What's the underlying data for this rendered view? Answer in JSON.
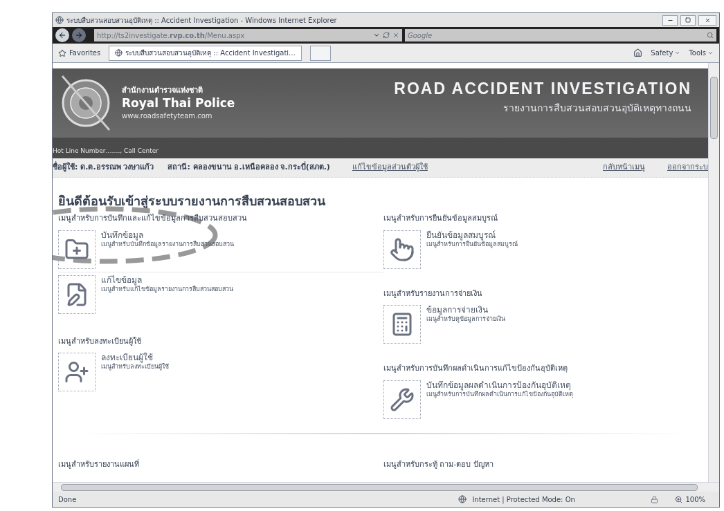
{
  "window": {
    "title": "ระบบสืบสวนสอบสวนอุบัติเหตุ :: Accident Investigation - Windows Internet Explorer"
  },
  "address_bar": {
    "url": "http://ts2investigate.**rvp.co.th**/Menu.aspx"
  },
  "search": {
    "placeholder": "Google"
  },
  "favorites_bar": {
    "favorites": "Favorites",
    "tabs": [
      {
        "title": "ระบบสืบสวนสอบสวนอุบัติเหตุ :: Accident Investigati...",
        "selected": true
      }
    ],
    "commands": [
      "Safety",
      "Tools"
    ]
  },
  "banner": {
    "org_thai": "สำนักงานตำรวจแห่งชาติ",
    "org": "Royal Thai Police",
    "website": "www.roadsafetyteam.com",
    "title": "ROAD ACCIDENT INVESTIGATION",
    "subtitle": "รายงานการสืบสวนสอบสวนอุบัติเหตุทางถนน"
  },
  "hotline": "Hot Line Number……., Call Center",
  "user_bar": {
    "user": "ชื่อผู้ใช้: ด.ต.อรรณพ วงษาแก้ว",
    "station": "สถานี: คลองขนาน อ.เหนือคลอง จ.กระบี่(สภต.)",
    "links": [
      "แก้ไขข้อมูลส่วนตัวผู้ใช้",
      "กลับหน้าเมนู",
      "ออกจากระบ"
    ]
  },
  "heading": "ยินดีต้อนรับเข้าสู่ระบบรายงานการสืบสวนสอบสวน",
  "columns": [
    [
      {
        "title": "เมนูสำหรับการบันทึกและแก้ไขข้อมูลการสืบสวนสอบสวน",
        "items": [
          {
            "kind": "folder",
            "title": "บันทึกข้อมูล",
            "description": "เมนูสำหรับบันทึกข้อมูลรายงานการสืบสวนสอบสวน"
          },
          {
            "kind": "pencil",
            "title": "แก้ไขข้อมูล",
            "description": "เมนูสำหรับแก้ไขข้อมูลรายงานการสืบสวนสอบสวน"
          }
        ]
      },
      {
        "title": "เมนูสำหรับลงทะเบียนผู้ใช้",
        "items": [
          {
            "kind": "user",
            "title": "ลงทะเบียนผู้ใช้",
            "description": "เมนูสำหรับลงทะเบียนผู้ใช้"
          }
        ]
      }
    ],
    [
      {
        "title": "เมนูสำหรับการยืนยันข้อมูลสมบูรณ์",
        "items": [
          {
            "kind": "hand",
            "title": "ยืนยันข้อมูลสมบูรณ์",
            "description": "เมนูสำหรับการยืนยันข้อมูลสมบูรณ์"
          }
        ]
      },
      {
        "title": "เมนูสำหรับรายงานการจ่ายเงิน",
        "items": [
          {
            "kind": "calculator",
            "title": "ข้อมูลการจ่ายเงิน",
            "description": "เมนูสำหรับดูข้อมูลการจ่ายเงิน"
          }
        ]
      },
      {
        "title": "เมนูสำหรับการบันทึกผลดำเนินการแก้ไขป้องกันอุบัติเหตุ",
        "items": [
          {
            "kind": "wrench",
            "title": "บันทึกข้อมูลผลดำเนินการป้องกันอุบัติเหตุ",
            "description": "เมนูสำหรับการบันทึกผลดำเนินการแก้ไขป้องกันอุบัติเหตุ"
          }
        ]
      }
    ]
  ],
  "footer_sections": [
    "เมนูสำหรับรายงานแผนที่",
    "เมนูสำหรับกระทู้ ถาม-ตอบ ปัญหา"
  ],
  "status_bar": {
    "text": "Done",
    "zone": "Internet | Protected Mode: On",
    "zoom": "100%"
  }
}
